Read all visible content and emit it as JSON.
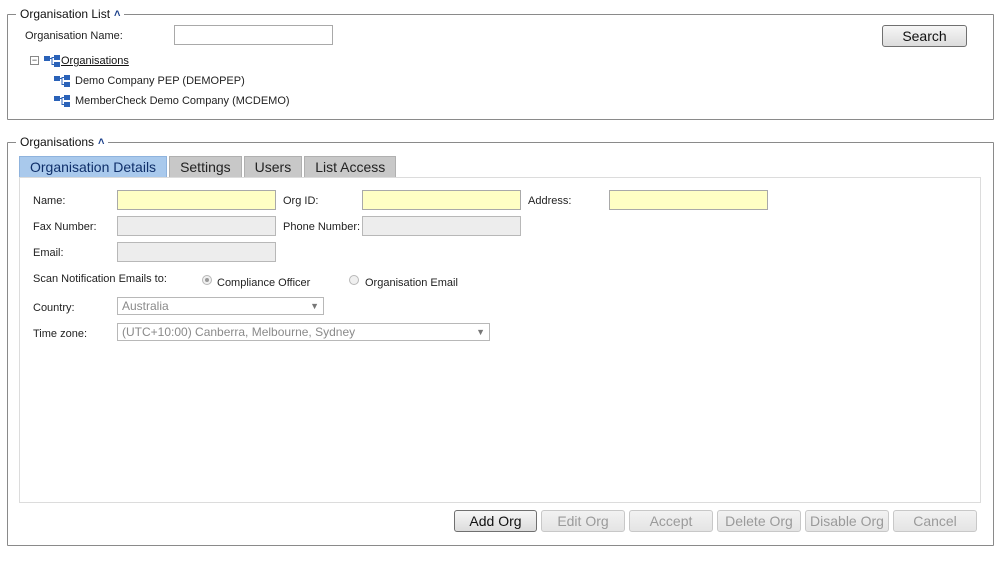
{
  "org_list": {
    "legend": "Organisation List",
    "org_name_label": "Organisation Name:",
    "org_name_value": "",
    "search_label": "Search",
    "tree": {
      "root_label": "Organisations",
      "children": [
        "Demo Company PEP (DEMOPEP)",
        "MemberCheck Demo Company (MCDEMO)"
      ]
    }
  },
  "organisations": {
    "legend": "Organisations",
    "tabs": [
      "Organisation Details",
      "Settings",
      "Users",
      "List Access"
    ],
    "active_tab": "Organisation Details",
    "form": {
      "name_label": "Name:",
      "org_id_label": "Org ID:",
      "address_label": "Address:",
      "fax_label": "Fax Number:",
      "phone_label": "Phone Number:",
      "email_label": "Email:",
      "scan_label": "Scan Notification Emails to:",
      "radio_compliance": "Compliance Officer",
      "radio_org_email": "Organisation Email",
      "country_label": "Country:",
      "country_value": "Australia",
      "timezone_label": "Time zone:",
      "timezone_value": "(UTC+10:00) Canberra, Melbourne, Sydney"
    },
    "buttons": {
      "add": "Add Org",
      "edit": "Edit Org",
      "accept": "Accept",
      "delete": "Delete Org",
      "disable": "Disable Org",
      "cancel": "Cancel"
    }
  },
  "colors": {
    "required_field": "#ffffc4",
    "active_tab": "#a9c9ec",
    "link": "#1a3f8a"
  }
}
